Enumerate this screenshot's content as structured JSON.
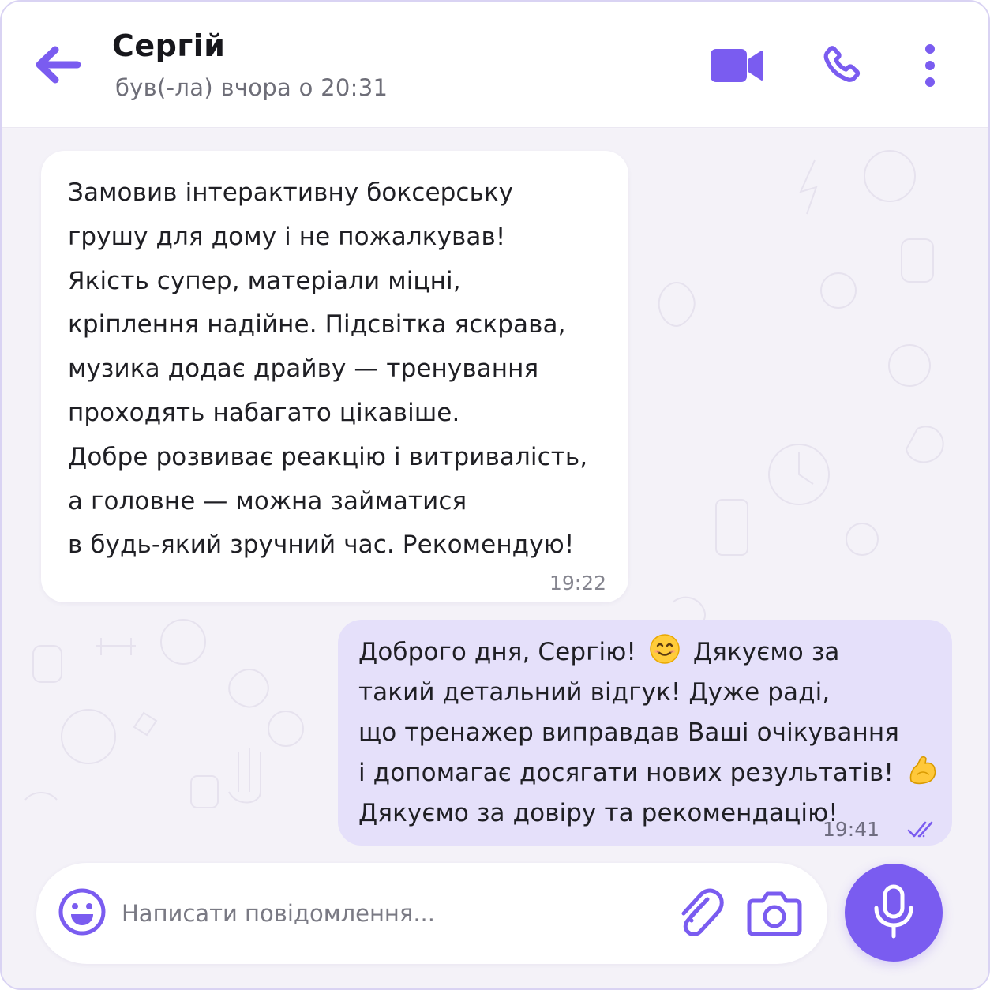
{
  "colors": {
    "accent": "#7a5cf0",
    "outgoing_bubble": "#e5e0fa",
    "incoming_bubble": "#ffffff",
    "chat_background": "#f4f2f8"
  },
  "header": {
    "contact_name": "Сергій",
    "last_seen": "був(-ла) вчора о 20:31",
    "icons": [
      "back-arrow-icon",
      "video-camera-icon",
      "phone-icon",
      "more-vertical-icon"
    ]
  },
  "messages": {
    "incoming": {
      "lines": [
        "Замовив інтерактивну боксерську",
        "грушу для дому і не пожалкував!",
        "Якість супер, матеріали міцні,",
        "кріплення надійне. Підсвітка яскрава,",
        "музика додає драйву — тренування",
        "проходять набагато цікавіше.",
        "Добре розвиває реакцію і витривалість,",
        "а головне — можна займатися",
        "в будь-який зручний час. Рекомендую!"
      ],
      "time": "19:22"
    },
    "outgoing": {
      "line1_a": "Доброго дня, Сергію!",
      "line1_b": "Дякуємо за",
      "line2": "такий детальний відгук! Дуже раді,",
      "line3": "що тренажер виправдав Ваші очікування",
      "line4": "і допомагає досягати нових результатів!",
      "line5": "Дякуємо за довіру та рекомендацію!",
      "emojis": [
        "smiling-face-emoji",
        "flexed-biceps-emoji"
      ],
      "time": "19:41",
      "status": "read"
    }
  },
  "composer": {
    "placeholder": "Написати повідомлення...",
    "icons": [
      "smile-icon",
      "paperclip-icon",
      "camera-icon",
      "microphone-icon"
    ]
  }
}
